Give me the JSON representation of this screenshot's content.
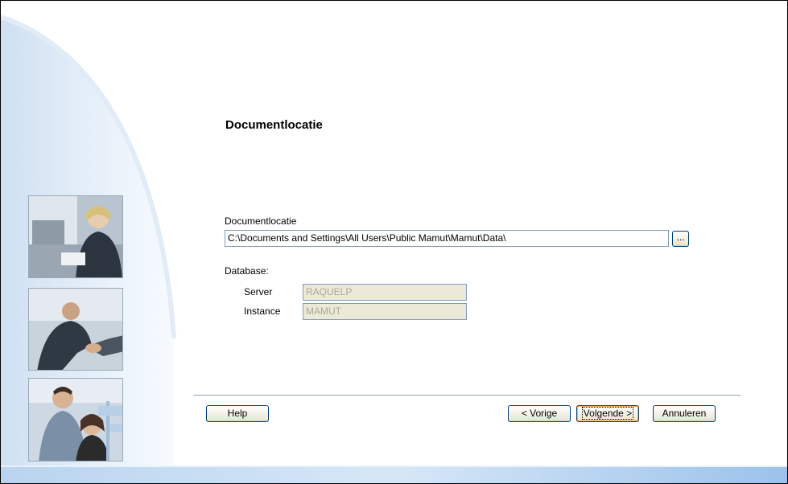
{
  "wizard": {
    "page_title": "Documentlocatie",
    "document_location": {
      "label": "Documentlocatie",
      "value": "C:\\Documents and Settings\\All Users\\Public Mamut\\Mamut\\Data\\",
      "browse_label": "..."
    },
    "database": {
      "label": "Database:",
      "server_label": "Server",
      "server_value": "RAQUELP",
      "instance_label": "Instance",
      "instance_value": "MAMUT"
    },
    "buttons": {
      "help": "Help",
      "back": "< Vorige",
      "next": "Volgende >",
      "cancel": "Annuleren"
    }
  },
  "colors": {
    "accent_blue": "#7fb2e5",
    "button_border": "#003c74",
    "disabled_field": "#ece9d8"
  }
}
